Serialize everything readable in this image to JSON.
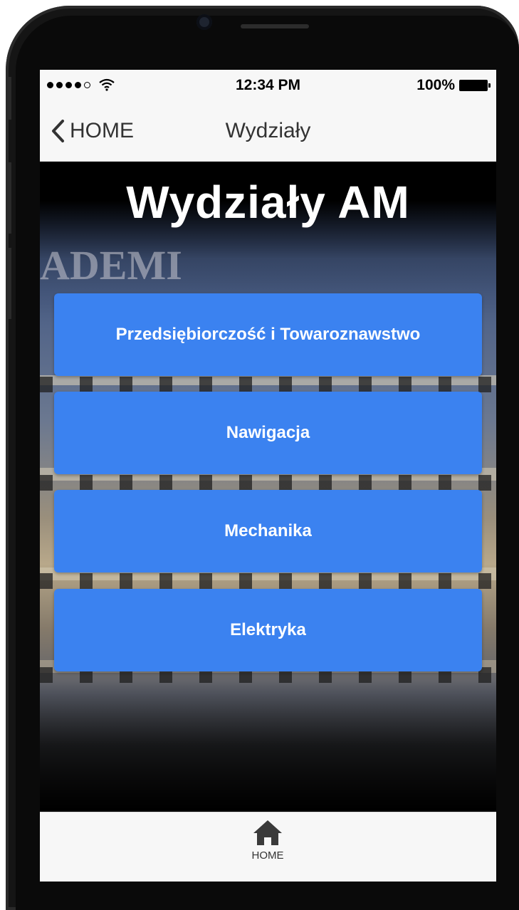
{
  "status_bar": {
    "signal_strength": 4,
    "signal_max": 5,
    "time": "12:34 PM",
    "battery_percent": "100%"
  },
  "nav_bar": {
    "back_label": "HOME",
    "title": "Wydziały"
  },
  "main": {
    "title": "Wydziały AM",
    "background_image_text": "ADEMI",
    "faculties": [
      {
        "label": "Przedsiębiorczość i Towaroznawstwo"
      },
      {
        "label": "Nawigacja"
      },
      {
        "label": "Mechanika"
      },
      {
        "label": "Elektryka"
      }
    ]
  },
  "tab_bar": {
    "home_label": "HOME",
    "home_icon": "home-icon"
  },
  "colors": {
    "button_blue": "#3b82f0",
    "bar_background": "#f7f7f7"
  }
}
